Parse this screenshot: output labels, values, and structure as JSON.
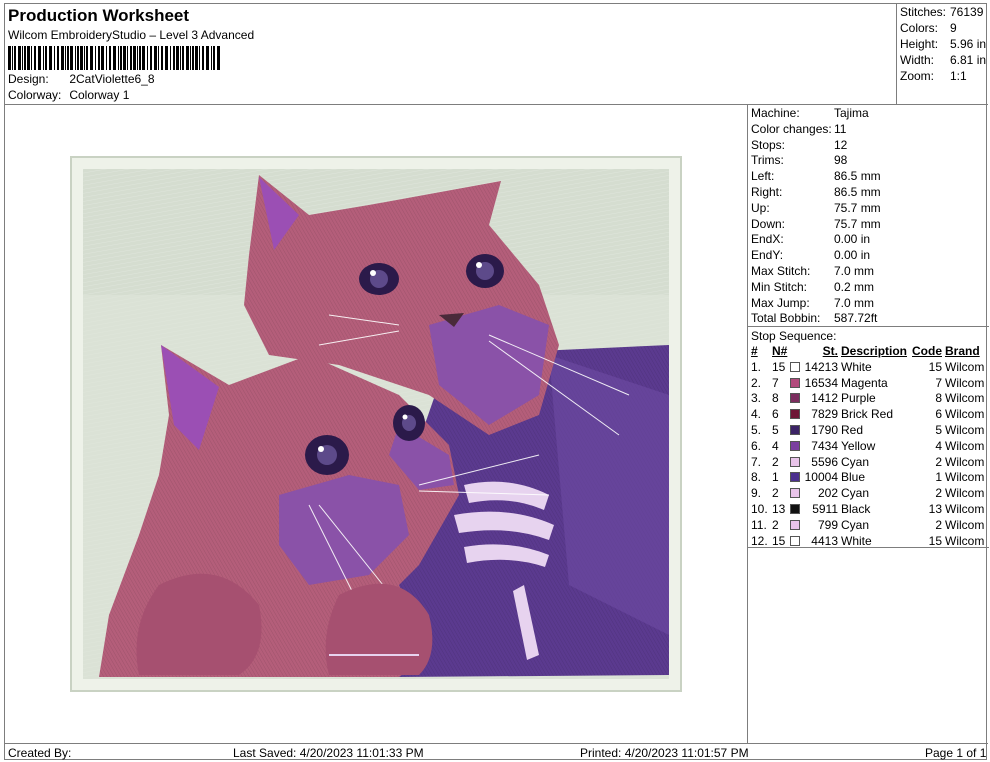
{
  "header": {
    "title": "Production Worksheet",
    "software": "Wilcom EmbroideryStudio – Level 3 Advanced",
    "design_label": "Design:",
    "design_value": "2CatViolette6_8",
    "colorway_label": "Colorway:",
    "colorway_value": "Colorway 1"
  },
  "summary": {
    "stitches_label": "Stitches:",
    "stitches": "76139",
    "colors_label": "Colors:",
    "colors": "9",
    "height_label": "Height:",
    "height": "5.96 in",
    "width_label": "Width:",
    "width": "6.81 in",
    "zoom_label": "Zoom:",
    "zoom": "1:1"
  },
  "machine_stats": [
    {
      "label": "Machine:",
      "value": "Tajima"
    },
    {
      "label": "Color changes:",
      "value": "11"
    },
    {
      "label": "Stops:",
      "value": "12"
    },
    {
      "label": "Trims:",
      "value": "98"
    },
    {
      "label": "Left:",
      "value": "86.5 mm"
    },
    {
      "label": "Right:",
      "value": "86.5 mm"
    },
    {
      "label": "Up:",
      "value": "75.7 mm"
    },
    {
      "label": "Down:",
      "value": "75.7 mm"
    },
    {
      "label": "EndX:",
      "value": "0.00 in"
    },
    {
      "label": "EndY:",
      "value": "0.00 in"
    },
    {
      "label": "Max Stitch:",
      "value": "7.0 mm"
    },
    {
      "label": "Min Stitch:",
      "value": "0.2 mm"
    },
    {
      "label": "Max Jump:",
      "value": "7.0 mm"
    },
    {
      "label": "Total Bobbin:",
      "value": "587.72ft"
    }
  ],
  "stop_sequence": {
    "title": "Stop Sequence:",
    "headers": {
      "num": "#",
      "n": "N#",
      "st": "St.",
      "desc": "Description",
      "code": "Code",
      "brand": "Brand"
    },
    "rows": [
      {
        "num": "1.",
        "n": "15",
        "color": "#ffffff",
        "st": "14213",
        "desc": "White",
        "code": "15",
        "brand": "Wilcom"
      },
      {
        "num": "2.",
        "n": "7",
        "color": "#b24a7c",
        "st": "16534",
        "desc": "Magenta",
        "code": "7",
        "brand": "Wilcom"
      },
      {
        "num": "3.",
        "n": "8",
        "color": "#7b2d5e",
        "st": "1412",
        "desc": "Purple",
        "code": "8",
        "brand": "Wilcom"
      },
      {
        "num": "4.",
        "n": "6",
        "color": "#6e1636",
        "st": "7829",
        "desc": "Brick Red",
        "code": "6",
        "brand": "Wilcom"
      },
      {
        "num": "5.",
        "n": "5",
        "color": "#3b2366",
        "st": "1790",
        "desc": "Red",
        "code": "5",
        "brand": "Wilcom"
      },
      {
        "num": "6.",
        "n": "4",
        "color": "#7b3fa0",
        "st": "7434",
        "desc": "Yellow",
        "code": "4",
        "brand": "Wilcom"
      },
      {
        "num": "7.",
        "n": "2",
        "color": "#e9c4ea",
        "st": "5596",
        "desc": "Cyan",
        "code": "2",
        "brand": "Wilcom"
      },
      {
        "num": "8.",
        "n": "1",
        "color": "#4b2f8e",
        "st": "10004",
        "desc": "Blue",
        "code": "1",
        "brand": "Wilcom"
      },
      {
        "num": "9.",
        "n": "2",
        "color": "#e9c4ea",
        "st": "202",
        "desc": "Cyan",
        "code": "2",
        "brand": "Wilcom"
      },
      {
        "num": "10.",
        "n": "13",
        "color": "#111111",
        "st": "5911",
        "desc": "Black",
        "code": "13",
        "brand": "Wilcom"
      },
      {
        "num": "11.",
        "n": "2",
        "color": "#e9c4ea",
        "st": "799",
        "desc": "Cyan",
        "code": "2",
        "brand": "Wilcom"
      },
      {
        "num": "12.",
        "n": "15",
        "color": "#ffffff",
        "st": "4413",
        "desc": "White",
        "code": "15",
        "brand": "Wilcom"
      }
    ]
  },
  "footer": {
    "created_by": "Created By:",
    "last_saved": "Last Saved: 4/20/2023 11:01:33 PM",
    "printed": "Printed: 4/20/2023 11:01:57 PM",
    "page": "Page 1 of 1"
  },
  "colors": {
    "border": "#7d7d7d",
    "frame_fill": "#e3eadf",
    "cat_pink": "#b45e7a",
    "cat_purple": "#8a52a8",
    "sweater": "#5b3a8f"
  }
}
